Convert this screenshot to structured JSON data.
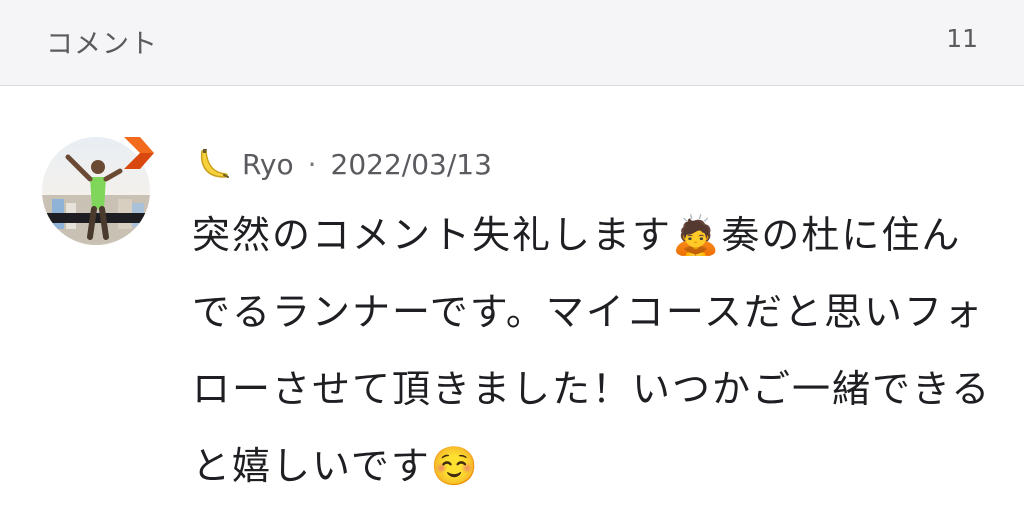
{
  "header": {
    "title": "コメント",
    "count": "11"
  },
  "comment": {
    "author_icon": "banana-icon",
    "author": "Ryo",
    "separator": "·",
    "date": "2022/03/13",
    "body": "突然のコメント失礼します🙇奏の杜に住んでるランナーです。マイコースだと思いフォローさせて頂きました！いつかご一緒できると嬉しいです☺️",
    "avatar_icon": "runner-photo",
    "badge_icon": "orange-chevron-badge-icon"
  }
}
